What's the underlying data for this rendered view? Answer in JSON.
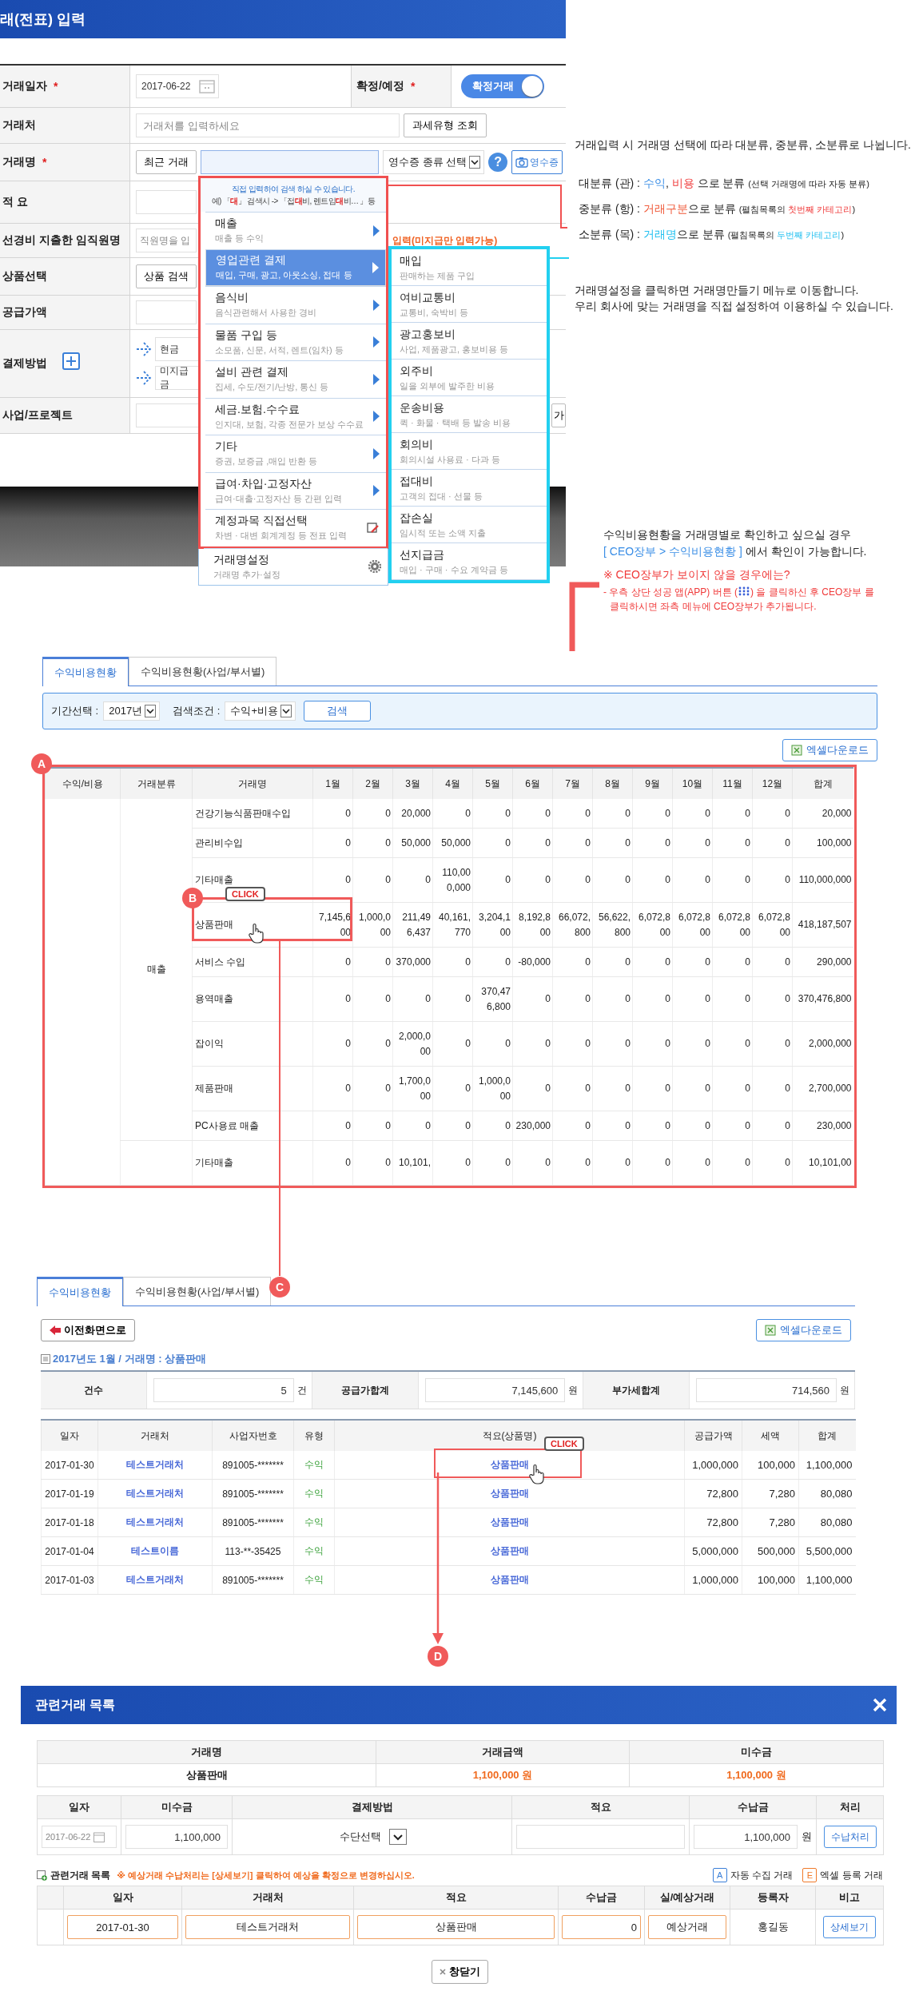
{
  "form": {
    "title": "래(전표) 입력",
    "required_mark": "*",
    "rows": [
      {
        "kind": "date",
        "label": "거래일자",
        "required": true,
        "value": "2017-06-22",
        "side_label": "확정/예정",
        "side_required": true,
        "toggle_label": "확정거래",
        "toggle_on": true
      },
      {
        "kind": "client",
        "label": "거래처",
        "required": false,
        "placeholder": "거래처를 입력하세요",
        "button": "과세유형 조회"
      },
      {
        "kind": "name",
        "label": "거래명",
        "required": true,
        "button": "최근 거래",
        "select": "영수증 종류 선택",
        "help": "?",
        "receipt_button": "영수증"
      },
      {
        "kind": "memo",
        "label": "적 요",
        "required": false
      },
      {
        "kind": "employee",
        "label": "선경비 지출한 임직원명",
        "required": false,
        "placeholder": "직원명을 입",
        "note": "입력(미지급만 입력가능)"
      },
      {
        "kind": "product",
        "label": "상품선택",
        "required": false,
        "button": "상품 검색"
      },
      {
        "kind": "supply",
        "label": "공급가액",
        "required": false
      },
      {
        "kind": "payment",
        "label": "결제방법",
        "required": false,
        "methods": [
          "현금",
          "미지급금"
        ]
      },
      {
        "kind": "project",
        "label": "사업/프로젝트",
        "required": false,
        "button": "가"
      }
    ]
  },
  "menu": {
    "hint": [
      "직접 입력하여 검색 하실 수 있습니다.",
      "예) 「**대**」 검색시 -> 「접**대**비, 렌트임**대**비… 」등"
    ],
    "items": [
      {
        "kind": "submenu",
        "title": "매출",
        "desc": "매출 등 수익",
        "selected": false
      },
      {
        "kind": "submenu",
        "title": "영업관련 결제",
        "desc": "매입, 구매, 광고, 아웃소싱, 접대 등",
        "selected": true
      },
      {
        "kind": "submenu",
        "title": "음식비",
        "desc": "음식관련해서 사용한 경비",
        "selected": false
      },
      {
        "kind": "submenu",
        "title": "물품 구입 등",
        "desc": "소모품, 신문, 서적, 렌트(임차) 등",
        "selected": false
      },
      {
        "kind": "submenu",
        "title": "설비 관련 결제",
        "desc": "집세, 수도/전기/난방, 통신 등",
        "selected": false
      },
      {
        "kind": "submenu",
        "title": "세금.보험.수수료",
        "desc": "인지대, 보험, 각종 전문가 보상 수수료",
        "selected": false
      },
      {
        "kind": "submenu",
        "title": "기타",
        "desc": "증권, 보증금 ,매입 반환 등",
        "selected": false
      },
      {
        "kind": "submenu",
        "title": "급여·차입·고정자산",
        "desc": "급여·대출·고정자산 등 간편 입력",
        "selected": false
      },
      {
        "kind": "edit",
        "title": "계정과목 직접선택",
        "desc": "차변 · 대변 회계계정 등 전표 입력",
        "selected": false
      },
      {
        "kind": "settings",
        "title": "거래명설정",
        "desc": "거래명 추가·설정",
        "selected": false
      }
    ],
    "sub_items": [
      {
        "title": "매입",
        "desc": "판매하는 제품 구입"
      },
      {
        "title": "여비교통비",
        "desc": "교통비, 숙박비 등"
      },
      {
        "title": "광고홍보비",
        "desc": "사업, 제품광고, 홍보비용 등"
      },
      {
        "title": "외주비",
        "desc": "일을 외부에 발주한 비용"
      },
      {
        "title": "운송비용",
        "desc": "퀵 · 화물 · 택배 등 발송 비용"
      },
      {
        "title": "회의비",
        "desc": "회의시설 사용료 · 다과 등"
      },
      {
        "title": "접대비",
        "desc": "고객의 접대 · 선물 등"
      },
      {
        "title": "잡손실",
        "desc": "임시적 또는 소액 지출"
      },
      {
        "title": "선지급금",
        "desc": "매입 · 구매 · 수요 계약금 등"
      }
    ]
  },
  "notes": {
    "intro": "거래입력 시 거래명 선택에 따라 대분류, 중분류, 소분류로 나뉩니다.",
    "levels": [
      [
        {
          "kind": "plain",
          "text": "대분류 (관) : "
        },
        {
          "kind": "blue",
          "text": "수익"
        },
        {
          "kind": "plain",
          "text": ", "
        },
        {
          "kind": "red",
          "text": "비용"
        },
        {
          "kind": "plain",
          "text": " 으로 분류 "
        },
        {
          "kind": "small",
          "text": "(선택 거래명에 따라 자동 분류)"
        }
      ],
      [
        {
          "kind": "plain",
          "text": "중분류 (항) : "
        },
        {
          "kind": "orange",
          "text": "거래구분"
        },
        {
          "kind": "plain",
          "text": "으로 분류 "
        },
        {
          "kind": "small",
          "text": "(펼침목록의 "
        },
        {
          "kind": "small-red",
          "text": "첫번째 카테고리"
        },
        {
          "kind": "small",
          "text": ")"
        }
      ],
      [
        {
          "kind": "plain",
          "text": "소분류 (목) : "
        },
        {
          "kind": "cyan",
          "text": "거래명"
        },
        {
          "kind": "plain",
          "text": "으로 분류 "
        },
        {
          "kind": "small",
          "text": "(펼침목록의 "
        },
        {
          "kind": "small-cyan",
          "text": "두번째 카테고리"
        },
        {
          "kind": "small",
          "text": ")"
        }
      ]
    ],
    "setting": [
      "거래명설정을 클릭하면 거래명만들기 메뉴로 이동합니다.",
      "우리 회사에 맞는 거래명을 직접 설정하여 이용하실 수 있습니다."
    ],
    "ceo_line": "수익비용현황을 거래명별로 확인하고 싶으실 경우",
    "ceo_path": "[ CEO장부 > 수익비용현황 ]",
    "ceo_path_after": " 에서 확인이 가능합니다.",
    "ceo_warning": "※ CEO장부가 보이지 않을 경우에는?",
    "ceo_detail_before": "- 우측 상단 성공 앱(APP) 버튼 (",
    "ceo_detail_after": ") 을 클릭하신 후 CEO장부 를",
    "ceo_detail_line2": "클릭하시면 좌측 메뉴에 CEO장부가 추가됩니다."
  },
  "callouts": {
    "a": "A",
    "b": "B",
    "click": "CLICK",
    "c": "C",
    "click_2": "CLICK",
    "d": "D"
  },
  "report": {
    "tabs": [
      {
        "label": "수익비용현황",
        "selected": true
      },
      {
        "label": "수익비용현황(사업/부서별)",
        "selected": false
      }
    ],
    "filter": {
      "period_label": "기간선택 :",
      "period": "2017년",
      "cond_label": "검색조건 :",
      "cond": "수익+비용",
      "search": "검색"
    },
    "excel": "엑셀다운로드",
    "columns": [
      "수익/비용",
      "거래분류",
      "거래명",
      "1월",
      "2월",
      "3월",
      "4월",
      "5월",
      "6월",
      "7월",
      "8월",
      "9월",
      "10월",
      "11월",
      "12월",
      "합계"
    ],
    "groups": [
      {
        "category": "매출",
        "rows": [
          {
            "name": "건강기능식품판매수입",
            "values": [
              "0",
              "0",
              "20,000",
              "0",
              "0",
              "0",
              "0",
              "0",
              "0",
              "0",
              "0",
              "0",
              "20,000"
            ]
          },
          {
            "name": "관리비수입",
            "values": [
              "0",
              "0",
              "50,000",
              "50,000",
              "0",
              "0",
              "0",
              "0",
              "0",
              "0",
              "0",
              "0",
              "100,000"
            ]
          },
          {
            "name": "기타매출",
            "values": [
              "0",
              "0",
              "0",
              "110,000,000",
              "0",
              "0",
              "0",
              "0",
              "0",
              "0",
              "0",
              "0",
              "110,000,000"
            ]
          },
          {
            "name": "상품판매",
            "values": [
              "7,145,600",
              "1,000,000",
              "211,496,437",
              "40,161,770",
              "3,204,100",
              "8,192,800",
              "66,072,800",
              "56,622,800",
              "6,072,800",
              "6,072,800",
              "6,072,800",
              "6,072,800",
              "418,187,507"
            ]
          },
          {
            "name": "서비스 수입",
            "values": [
              "0",
              "0",
              "370,000",
              "0",
              "0",
              "-80,000",
              "0",
              "0",
              "0",
              "0",
              "0",
              "0",
              "290,000"
            ]
          },
          {
            "name": "용역매출",
            "values": [
              "0",
              "0",
              "0",
              "0",
              "370,476,800",
              "0",
              "0",
              "0",
              "0",
              "0",
              "0",
              "0",
              "370,476,800"
            ]
          },
          {
            "name": "잡이익",
            "values": [
              "0",
              "0",
              "2,000,000",
              "0",
              "0",
              "0",
              "0",
              "0",
              "0",
              "0",
              "0",
              "0",
              "2,000,000"
            ]
          },
          {
            "name": "제품판매",
            "values": [
              "0",
              "0",
              "1,700,000",
              "0",
              "1,000,000",
              "0",
              "0",
              "0",
              "0",
              "0",
              "0",
              "0",
              "2,700,000"
            ]
          },
          {
            "name": "PC사용료 매출",
            "values": [
              "0",
              "0",
              "0",
              "0",
              "0",
              "230,000",
              "0",
              "0",
              "0",
              "0",
              "0",
              "0",
              "230,000"
            ]
          }
        ]
      },
      {
        "rows": [
          {
            "name": "기타매출",
            "values": [
              "0",
              "0",
              "10,101,",
              "0",
              "0",
              "0",
              "0",
              "0",
              "0",
              "0",
              "0",
              "0",
              "10,101,00"
            ]
          }
        ]
      }
    ]
  },
  "detail": {
    "tabs": [
      {
        "label": "수익비용현황",
        "selected": true
      },
      {
        "label": "수익비용현황(사업/부서별)",
        "selected": false
      }
    ],
    "back": "이전화면으로",
    "excel": "엑셀다운로드",
    "caption": "2017년도 1월 / 거래명 : 상품판매",
    "summary": [
      {
        "label": "건수",
        "value": "5",
        "unit": "건"
      },
      {
        "label": "공급가합계",
        "value": "7,145,600",
        "unit": "원"
      },
      {
        "label": "부가세합계",
        "value": "714,560",
        "unit": "원"
      }
    ],
    "columns": [
      "일자",
      "거래처",
      "사업자번호",
      "유형",
      "적요(상품명)",
      "공급가액",
      "세액",
      "합계"
    ],
    "rows": [
      [
        "2017-01-30",
        "테스트거래처",
        "891005-*******",
        "수익",
        "상품판매",
        "1,000,000",
        "100,000",
        "1,100,000"
      ],
      [
        "2017-01-19",
        "테스트거래처",
        "891005-*******",
        "수익",
        "상품판매",
        "72,800",
        "7,280",
        "80,080"
      ],
      [
        "2017-01-18",
        "테스트거래처",
        "891005-*******",
        "수익",
        "상품판매",
        "72,800",
        "7,280",
        "80,080"
      ],
      [
        "2017-01-04",
        "테스트이름",
        "113-**-35425",
        "수익",
        "상품판매",
        "5,000,000",
        "500,000",
        "5,500,000"
      ],
      [
        "2017-01-03",
        "테스트거래처",
        "891005-*******",
        "수익",
        "상품판매",
        "1,000,000",
        "100,000",
        "1,100,000"
      ]
    ]
  },
  "dialog": {
    "title": "관련거래 목록",
    "summary_columns": [
      "거래명",
      "거래금액",
      "미수금"
    ],
    "summary_values": [
      "상품판매",
      "1,100,000 원",
      "1,100,000 원"
    ],
    "entry_columns": [
      "일자",
      "미수금",
      "결제방법",
      "적요",
      "수납금",
      "처리"
    ],
    "entry": {
      "date": "2017-06-22",
      "unpaid": "1,100,000",
      "method": "수단선택",
      "received": "1,100,000",
      "unit": "원",
      "action": "수납처리"
    },
    "list_title": "관련거래 목록",
    "list_warning": "※ 예상거래 수납처리는 [상세보기] 클릭하여 예상을 확정으로 변경하십시오.",
    "legend": [
      {
        "badge": "A",
        "label": "자동 수집 거래",
        "color": "#3a7fd8"
      },
      {
        "badge": "E",
        "label": "엑셀 등록 거래",
        "color": "#f07a2a"
      }
    ],
    "list_columns": [
      "일자",
      "거래처",
      "적요",
      "수납금",
      "실/예상거래",
      "등록자",
      "비고"
    ],
    "list_rows": [
      {
        "date": "2017-01-30",
        "client": "테스트거래처",
        "memo": "상품판매",
        "received": "0",
        "type": "예상거래",
        "registrant": "홍길동",
        "action": "상세보기"
      }
    ],
    "close": "창닫기"
  }
}
